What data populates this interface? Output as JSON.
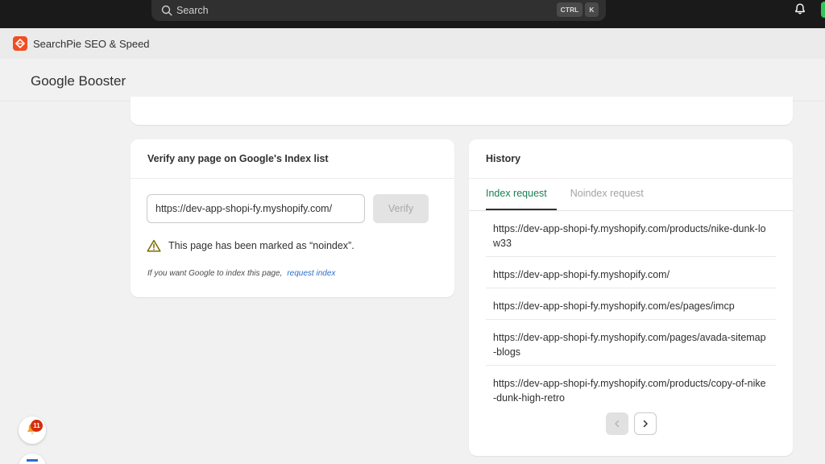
{
  "topbar": {
    "search_placeholder": "Search",
    "shortcut_ctrl": "CTRL",
    "shortcut_key": "K"
  },
  "app": {
    "name": "SearchPie SEO & Speed",
    "brand_color": "#f04e23"
  },
  "page": {
    "title": "Google Booster"
  },
  "verify_card": {
    "title": "Verify any page on Google's Index list",
    "url_value": "https://dev-app-shopi-fy.myshopify.com/",
    "verify_label": "Verify",
    "warning_text": "This page has been marked as “noindex”.",
    "hint_text": "If you want Google to index this page,",
    "hint_link": "request index"
  },
  "history_card": {
    "title": "History",
    "tabs": [
      {
        "label": "Index request",
        "active": true
      },
      {
        "label": "Noindex request",
        "active": false
      }
    ],
    "items": [
      "https://dev-app-shopi-fy.myshopify.com/products/nike-dunk-low33",
      "https://dev-app-shopi-fy.myshopify.com/",
      "https://dev-app-shopi-fy.myshopify.com/es/pages/imcp",
      "https://dev-app-shopi-fy.myshopify.com/pages/avada-sitemap-blogs",
      "https://dev-app-shopi-fy.myshopify.com/products/copy-of-nike-dunk-high-retro"
    ],
    "active_tab_color": "#1a7f52"
  },
  "notifications": {
    "badge_count": "11"
  }
}
